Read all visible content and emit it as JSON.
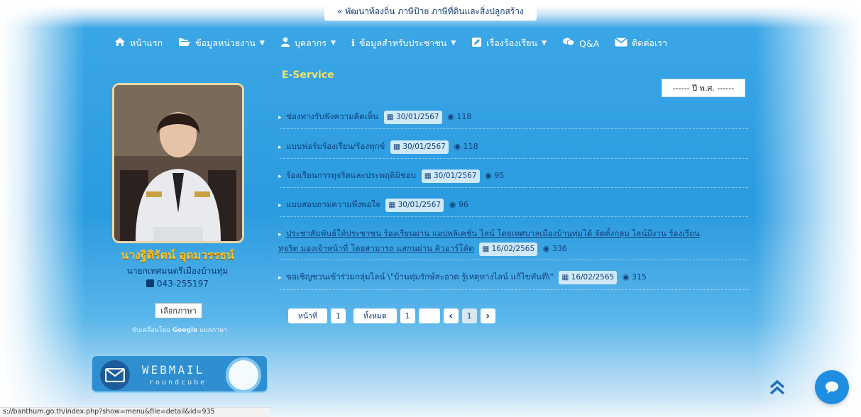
{
  "marquee": "พัฒนาท้องถิ่น ภาษีป้าย ภาษีที่ดินและสิ่งปลูกสร้าง",
  "marquee_prefix": "«",
  "nav": [
    {
      "label": "หน้าแรก",
      "icon": "home-icon",
      "caret": false
    },
    {
      "label": "ข้อมูลหน่วยงาน",
      "icon": "folder-open-icon",
      "caret": true
    },
    {
      "label": "บุคลากร",
      "icon": "user-icon",
      "caret": true
    },
    {
      "label": "ข้อมูลสำหรับประชาชน",
      "icon": "info-icon",
      "caret": true
    },
    {
      "label": "เรื่องร้องเรียน",
      "icon": "edit-icon",
      "caret": true
    },
    {
      "label": "Q&A",
      "icon": "comments-icon",
      "caret": false
    },
    {
      "label": "ติดต่อเรา",
      "icon": "envelope-icon",
      "caret": false
    }
  ],
  "mayor": {
    "name": "นางฐิติรัตน์ อุดมวรรธน์",
    "title": "นายกเทศมนตรีเมืองบ้านทุ่ม",
    "phone": "043-255197"
  },
  "language_button": "เลือกภาษา",
  "powered_by": {
    "prefix": "ขับเคลื่อนโดย",
    "brand": "Google",
    "suffix": "แปลภาษา"
  },
  "webmail": {
    "title": "WEBMAIL",
    "subtitle": "roundcube"
  },
  "section_title": "E-Service",
  "year_select": "------ ปี พ.ศ. ------",
  "items": [
    {
      "text": "ช่องทางรับฟังความคิดเห็น",
      "date": "30/01/2567",
      "views": "118"
    },
    {
      "text": "แบบฟอร์มร้องเรียน/ร้องทุกข์",
      "date": "30/01/2567",
      "views": "118"
    },
    {
      "text": "ร้องเรียนการทุจริตและประพฤติมิชอบ",
      "date": "30/01/2567",
      "views": "95"
    },
    {
      "text": "แบบสอบถามความพึงพอใจ",
      "date": "30/01/2567",
      "views": "96"
    },
    {
      "text_line1": "ประชาสัมพันธ์ให้ประชาชน ร้องเรียนผ่าน แอปพลิเคชั่น ไลน์ โดยเทศบาลเมืองบ้านทุ่มได้ จัดตั้งกลุ่ม ไลน์มีงาน ร้องเรียน",
      "text_line2": "ทุจริต มองเจ้าหน้าที่ โดยสามารถ แสกนผ่าน คิวอาร์โค้ด",
      "date": "16/02/2565",
      "views": "336"
    },
    {
      "text": "ขอเชิญชวนเข้าร่วมกลุ่มไลน์ \\\"บ้านทุ่มรักษ์สะอาด รู้เหตุทางไลน์ แก้ไขทันที\\\"",
      "date": "16/02/2565",
      "views": "315"
    }
  ],
  "pager": {
    "page_label": "หน้าที่",
    "page_value": "1",
    "total_label": "ทั้งหมด",
    "total_value": "1",
    "current": "1",
    "prev": "‹",
    "next": "›"
  },
  "status_url": "s://banthum.go.th/index.php?show=menu&file=detail&id=935"
}
